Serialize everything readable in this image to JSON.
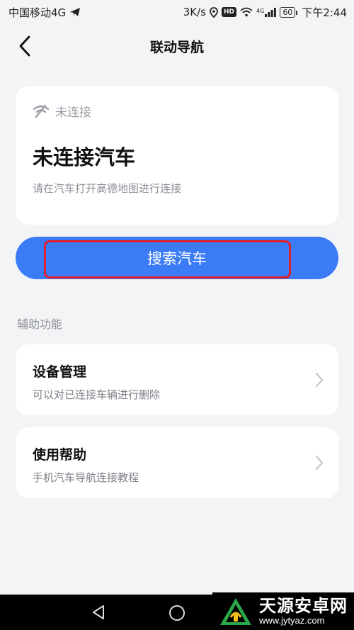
{
  "status_bar": {
    "carrier": "中国移动4G",
    "speed": "3K/s",
    "hd": "HD",
    "signal": "4G",
    "battery": "60",
    "time": "下午2:44"
  },
  "header": {
    "title": "联动导航"
  },
  "connection_card": {
    "status_label": "未连接",
    "title": "未连接汽车",
    "subtitle": "请在汽车打开高德地图进行连接"
  },
  "search_button": {
    "label": "搜索汽车"
  },
  "section": {
    "label": "辅助功能"
  },
  "list_items": [
    {
      "title": "设备管理",
      "description": "可以对已连接车辆进行删除"
    },
    {
      "title": "使用帮助",
      "description": "手机汽车导航连接教程"
    }
  ],
  "watermark": {
    "title": "天源安卓网",
    "url": "www.jytyaz.com"
  },
  "colors": {
    "accent": "#3b7bf6",
    "highlight": "#e0202a",
    "background": "#f3f4f6"
  }
}
